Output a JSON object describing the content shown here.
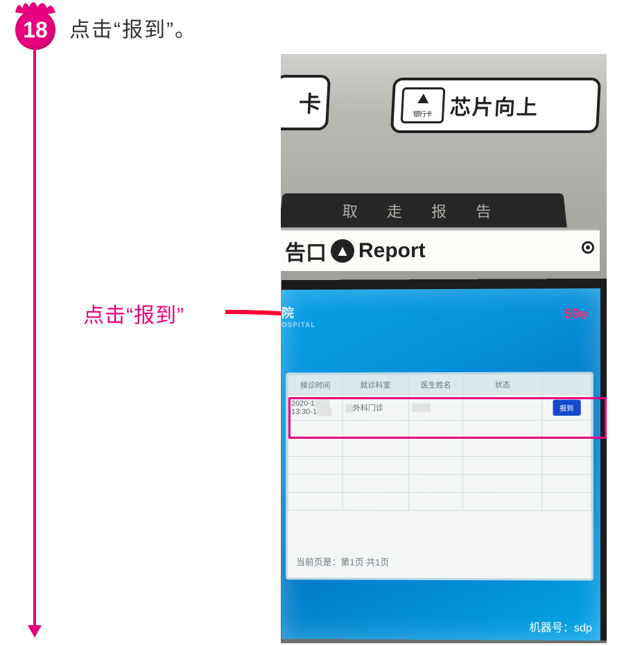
{
  "step": {
    "number": "18",
    "title": "点击“报到”。"
  },
  "callout": {
    "label": "点击“报到”"
  },
  "kiosk": {
    "slot1_label": "卡",
    "slot2_icon_text": "银行卡",
    "slot2_label": "芯片向上",
    "receipt_slot_text": "取  走  报  告",
    "report_label_left": "告口",
    "report_label_right": "Report"
  },
  "screen": {
    "hospital_suffix": "院",
    "hospital_sub": "OSPITAL",
    "timer_value": "59",
    "timer_unit": "秒",
    "table": {
      "headers": [
        "候诊时间",
        "就诊科室",
        "医生姓名",
        "状态",
        ""
      ],
      "row1": {
        "time_line1": "2020-1",
        "time_line2": "13:30-1",
        "dept": "外科门诊",
        "doctor": "",
        "status": "",
        "action": "报到"
      }
    },
    "pager": "当前页是：第1页 共1页",
    "machine_id": "机器号：sdp"
  },
  "colors": {
    "accent": "#e6007e",
    "kiosk_blue": "#0aa0e6",
    "button_blue": "#1449c9"
  }
}
